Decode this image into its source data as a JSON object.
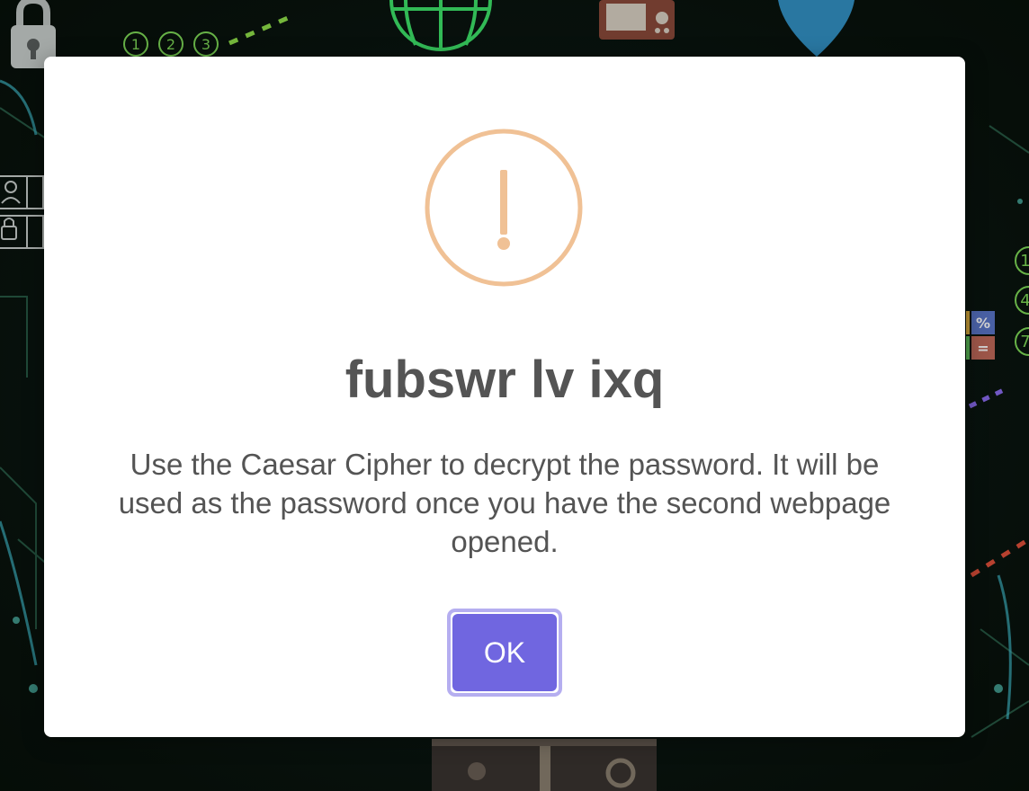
{
  "background": {
    "step_badges_top": [
      "1",
      "2",
      "3"
    ],
    "step_badges_right": [
      "1",
      "4",
      "7"
    ],
    "calc_keys": [
      "%",
      "="
    ],
    "icons": [
      "padlock-icon",
      "globe-icon",
      "radio-icon",
      "location-pin-icon",
      "user-icon",
      "lock-icon",
      "treasure-chest-icon"
    ]
  },
  "dialog": {
    "icon": "exclamation-warning-icon",
    "icon_color": "#f0c195",
    "title": "fubswr lv ixq",
    "message": "Use the Caesar Cipher to decrypt the password. It will be used as the password once you have the second webpage opened.",
    "confirm_label": "OK",
    "confirm_color": "#7066e0"
  }
}
